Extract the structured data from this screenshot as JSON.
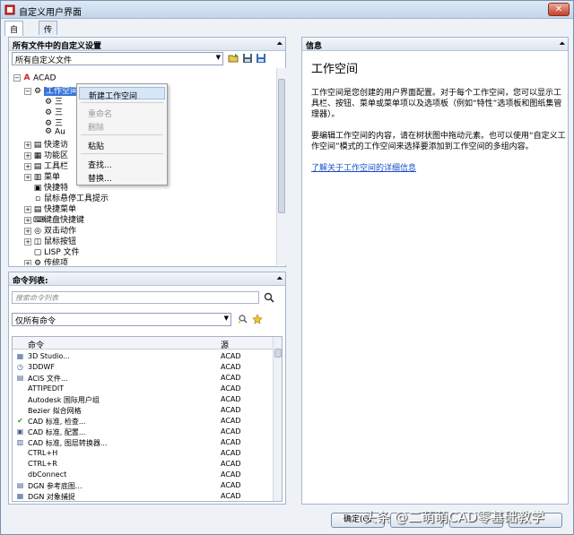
{
  "window": {
    "title": "自定义用户界面",
    "close_glyph": "✕"
  },
  "tabs": [
    {
      "label": "自定义"
    },
    {
      "label": "传输"
    }
  ],
  "customizations_panel": {
    "header": "所有文件中的自定义设置",
    "file_select": "所有自定义文件",
    "tree": [
      {
        "label": "ACAD",
        "indent": 0,
        "expander": "⊟",
        "icon": "acad-icon",
        "glyph": "A"
      },
      {
        "label": "工作空间",
        "indent": 1,
        "expander": "⊟",
        "icon": "gear-icon",
        "glyph": "⚙",
        "selected": true
      },
      {
        "label": "三",
        "indent": 2,
        "expander": "",
        "icon": "gear-icon",
        "glyph": "⚙"
      },
      {
        "label": "三",
        "indent": 2,
        "expander": "",
        "icon": "gear-icon",
        "glyph": "⚙"
      },
      {
        "label": "三",
        "indent": 2,
        "expander": "",
        "icon": "gear-icon",
        "glyph": "⚙"
      },
      {
        "label": "Au",
        "indent": 2,
        "expander": "",
        "icon": "gear-icon",
        "glyph": "⚙"
      },
      {
        "label": "快速访",
        "indent": 1,
        "expander": "⊞",
        "icon": "toolbar-icon",
        "glyph": "▤"
      },
      {
        "label": "功能区",
        "indent": 1,
        "expander": "⊞",
        "icon": "ribbon-icon",
        "glyph": "▦"
      },
      {
        "label": "工具栏",
        "indent": 1,
        "expander": "⊞",
        "icon": "toolbar-icon",
        "glyph": "▤"
      },
      {
        "label": "菜单",
        "indent": 1,
        "expander": "⊞",
        "icon": "menu-icon",
        "glyph": "▥"
      },
      {
        "label": "快捷特",
        "indent": 1,
        "expander": "",
        "icon": "quick-properties-icon",
        "glyph": "▣"
      },
      {
        "label": "鼠标悬停工具提示",
        "indent": 1,
        "expander": "",
        "icon": "tooltip-icon",
        "glyph": "▫"
      },
      {
        "label": "快捷菜单",
        "indent": 1,
        "expander": "⊞",
        "icon": "shortcut-menu-icon",
        "glyph": "▤"
      },
      {
        "label": "键盘快捷键",
        "indent": 1,
        "expander": "⊞",
        "icon": "keyboard-icon",
        "glyph": "⌨"
      },
      {
        "label": "双击动作",
        "indent": 1,
        "expander": "⊞",
        "icon": "double-click-icon",
        "glyph": "◎"
      },
      {
        "label": "鼠标按钮",
        "indent": 1,
        "expander": "⊞",
        "icon": "mouse-icon",
        "glyph": "◫"
      },
      {
        "label": "LISP 文件",
        "indent": 1,
        "expander": "",
        "icon": "lisp-icon",
        "glyph": "▢"
      },
      {
        "label": "传统项",
        "indent": 1,
        "expander": "⊞",
        "icon": "legacy-icon",
        "glyph": "⚙"
      }
    ]
  },
  "context_menu": {
    "items": [
      {
        "label": "新建工作空间",
        "enabled": true,
        "highlighted": true
      },
      {
        "label": "重命名",
        "enabled": false
      },
      {
        "label": "删除",
        "enabled": false
      },
      {
        "label": "粘贴",
        "enabled": true
      },
      {
        "label": "查找...",
        "enabled": true
      },
      {
        "label": "替换...",
        "enabled": true
      }
    ]
  },
  "commands_panel": {
    "header": "命令列表:",
    "search_placeholder": "搜索命令列表",
    "filter_select": "仅所有命令",
    "columns": {
      "command": "命令",
      "source": "源"
    },
    "rows": [
      {
        "icon": "3d-studio-icon",
        "glyph": "▦",
        "name": "3D Studio...",
        "source": "ACAD"
      },
      {
        "icon": "3ddwf-icon",
        "glyph": "◷",
        "name": "3DDWF",
        "source": "ACAD"
      },
      {
        "icon": "acis-icon",
        "glyph": "▤",
        "name": "ACIS 文件...",
        "source": "ACAD"
      },
      {
        "icon": "",
        "glyph": "",
        "name": "ATTIPEDIT",
        "source": "ACAD"
      },
      {
        "icon": "",
        "glyph": "",
        "name": "Autodesk 国际用户组",
        "source": "ACAD"
      },
      {
        "icon": "",
        "glyph": "",
        "name": "Bezier 拟合网格",
        "source": "ACAD"
      },
      {
        "icon": "check-icon",
        "glyph": "✔",
        "name": "CAD 标准, 检查...",
        "source": "ACAD"
      },
      {
        "icon": "standards-config-icon",
        "glyph": "▣",
        "name": "CAD 标准, 配置...",
        "source": "ACAD"
      },
      {
        "icon": "layer-translator-icon",
        "glyph": "▥",
        "name": "CAD 标准, 图层转换器...",
        "source": "ACAD"
      },
      {
        "icon": "",
        "glyph": "",
        "name": "CTRL+H",
        "source": "ACAD"
      },
      {
        "icon": "",
        "glyph": "",
        "name": "CTRL+R",
        "source": "ACAD"
      },
      {
        "icon": "",
        "glyph": "",
        "name": "dbConnect",
        "source": "ACAD"
      },
      {
        "icon": "dgn-underlay-icon",
        "glyph": "▤",
        "name": "DGN 参考底图...",
        "source": "ACAD"
      },
      {
        "icon": "dgn-snap-icon",
        "glyph": "▦",
        "name": "DGN 对象捕捉",
        "source": "ACAD"
      }
    ]
  },
  "info_panel": {
    "header": "信息",
    "heading": "工作空间",
    "paragraph1": "工作空间是您创建的用户界面配置。对于每个工作空间，您可以显示工具栏、按钮、菜单或菜单项以及选项板（例如“特性”选项板和图纸集管理器）。",
    "paragraph2": "要编辑工作空间的内容，请在树状图中拖动元素。也可以使用“自定义工作空间”模式的工作空间来选择要添加到工作空间的多组内容。",
    "link": "了解关于工作空间的详细信息"
  },
  "buttons": {
    "ok": "确定(O)"
  },
  "watermark": "头条 @二萌萌CAD零基础教学"
}
